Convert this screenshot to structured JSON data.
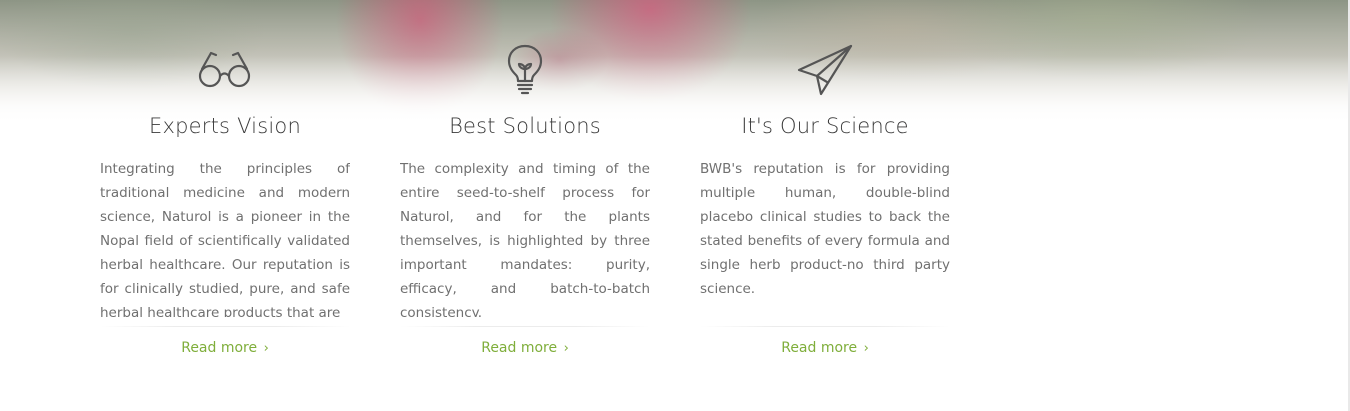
{
  "colors": {
    "accent": "#7fae3b",
    "title": "#3a3a3a",
    "body_text": "#707070",
    "icon": "#555555"
  },
  "features": [
    {
      "icon": "glasses-icon",
      "title": "Experts Vision",
      "text": "Integrating the principles of traditional medicine and modern science, Naturol is a pioneer in the Nopal field of scientifically validated herbal healthcare. Our reputation is for clinically studied, pure, and safe herbal healthcare products that are",
      "link_label": "Read more",
      "link_chevron": "›"
    },
    {
      "icon": "lightbulb-icon",
      "title": "Best Solutions",
      "text": "The complexity and timing of the entire seed-to-shelf process for Naturol, and for the plants themselves, is highlighted by three important mandates: purity, efficacy, and batch-to-batch consistency.",
      "link_label": "Read more",
      "link_chevron": "›"
    },
    {
      "icon": "paper-plane-icon",
      "title": "It's Our Science",
      "text": "BWB's reputation is for providing multiple human, double-blind placebo clinical studies to back the stated benefits of every formula and single herb product-no third party science.",
      "link_label": "Read more",
      "link_chevron": "›"
    }
  ]
}
